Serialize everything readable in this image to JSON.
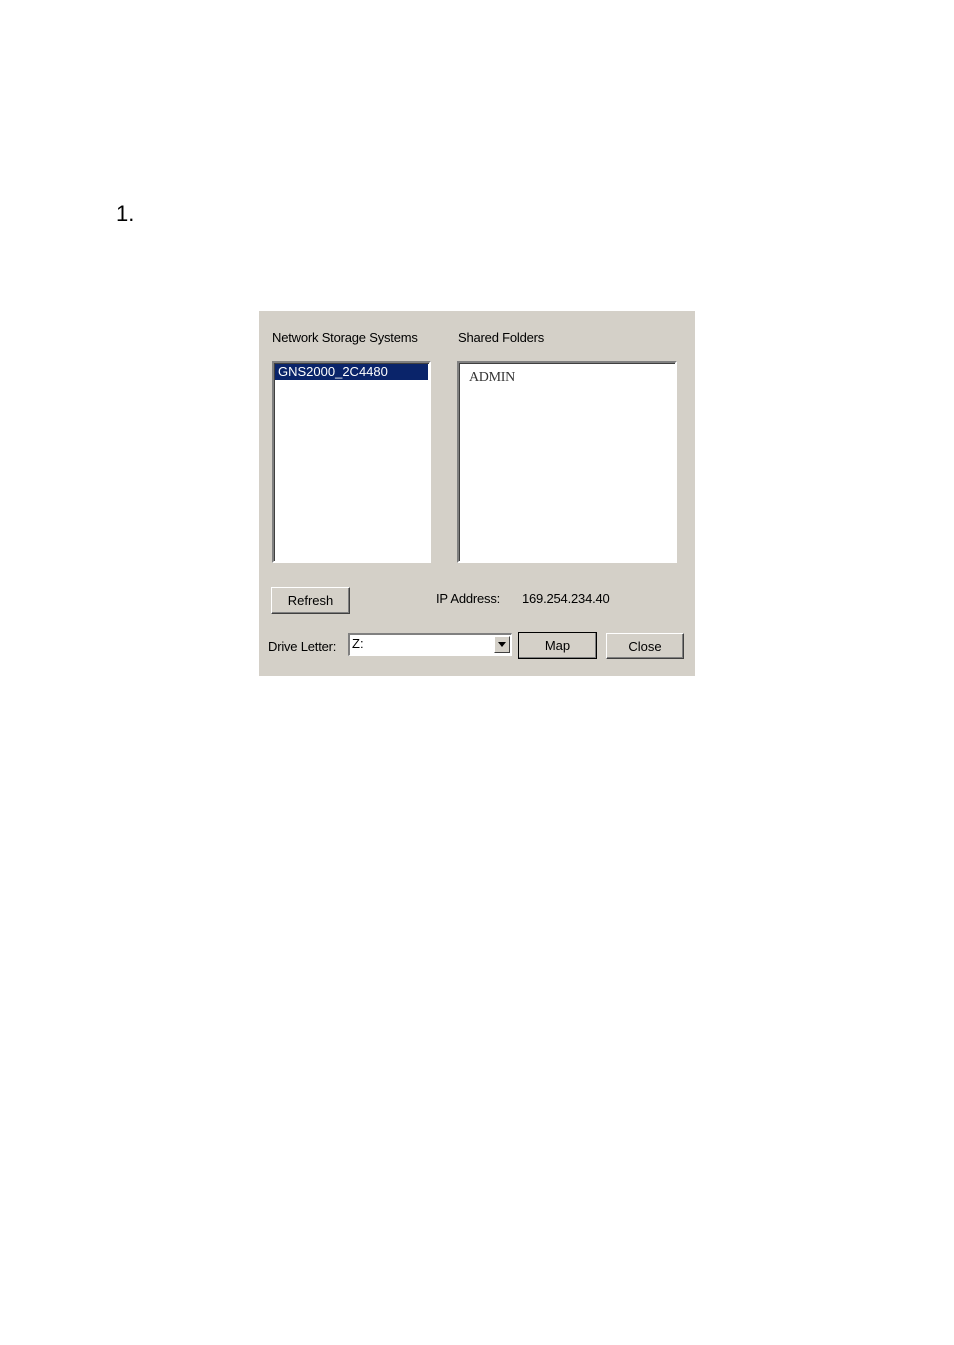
{
  "step_number": "1.",
  "dialog": {
    "storage_label": "Network Storage Systems",
    "folders_label": "Shared Folders",
    "storage_items": [
      "GNS2000_2C4480"
    ],
    "folder_items": [
      "ADMIN"
    ],
    "refresh_label": "Refresh",
    "ip_label": "IP Address:",
    "ip_value": "169.254.234.40",
    "drive_label": "Drive Letter:",
    "drive_value": "Z:",
    "map_label": "Map",
    "close_label": "Close"
  },
  "colors": {
    "dialog_bg": "#d4d0c8",
    "selection": "#0a246a"
  }
}
